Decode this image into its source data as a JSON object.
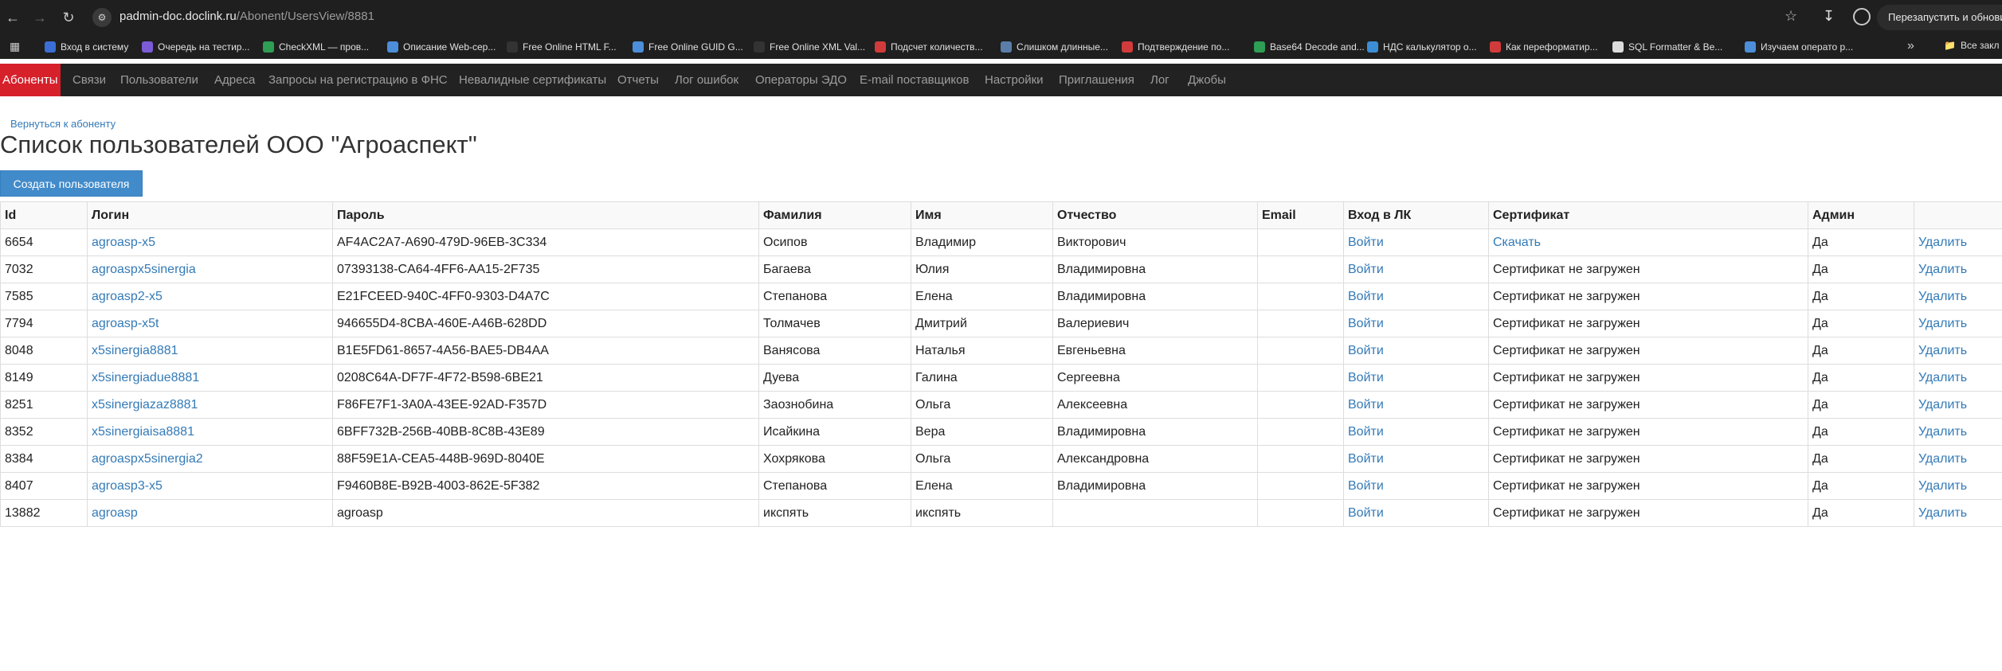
{
  "browser": {
    "url_host": "padmin-doc.doclink.ru",
    "url_path": "/Abonent/UsersView/8881",
    "relaunch_label": "Перезапустить и обновит"
  },
  "bookmarks": [
    {
      "label": "Вход в систему",
      "color": "#3b6fd6"
    },
    {
      "label": "Очередь на тестир...",
      "color": "#7b5cd6"
    },
    {
      "label": "CheckXML — пров...",
      "color": "#2e9e55"
    },
    {
      "label": "Описание Web-сер...",
      "color": "#4c8ed9"
    },
    {
      "label": "Free Online HTML F...",
      "color": "#333333"
    },
    {
      "label": "Free Online GUID G...",
      "color": "#4c8ed9"
    },
    {
      "label": "Free Online XML Val...",
      "color": "#333333"
    },
    {
      "label": "Подсчет количеств...",
      "color": "#d23b3b"
    },
    {
      "label": "Слишком длинные...",
      "color": "#5b7ea8"
    },
    {
      "label": "Подтверждение по...",
      "color": "#d23b3b"
    },
    {
      "label": "Base64 Decode and...",
      "color": "#2e9e55"
    },
    {
      "label": "НДС калькулятор о...",
      "color": "#3b8ed6"
    },
    {
      "label": "Как переформатир...",
      "color": "#d23b3b"
    },
    {
      "label": "SQL Formatter & Be...",
      "color": "#dddddd"
    },
    {
      "label": "Изучаем операто р...",
      "color": "#4c8ed9"
    }
  ],
  "bookmarks_folder": "Все закл",
  "nav": {
    "items": [
      "Абоненты",
      "Связи",
      "Пользователи",
      "Адреса",
      "Запросы на регистрацию в ФНС",
      "Невалидные сертификаты",
      "Отчеты",
      "Лог ошибок",
      "Операторы ЭДО",
      "E-mail поставщиков",
      "Настройки",
      "Приглашения",
      "Лог",
      "Джобы"
    ],
    "active": "Абоненты"
  },
  "back_link": "Вернуться к абоненту",
  "page_title": "Список пользователей ООО \"Агроаспект\"",
  "create_button": "Создать пользователя",
  "table": {
    "headers": [
      "Id",
      "Логин",
      "Пароль",
      "Фамилия",
      "Имя",
      "Отчество",
      "Email",
      "Вход в ЛК",
      "Сертификат",
      "Админ",
      ""
    ],
    "rows": [
      [
        "6654",
        "agroasp-x5",
        "AF4AC2A7-A690-479D-96EB-3C334",
        "Осипов",
        "Владимир",
        "Викторович",
        "",
        "Войти",
        "Скачать",
        "Да",
        "Удалить"
      ],
      [
        "7032",
        "agroaspx5sinergia",
        "07393138-CA64-4FF6-AA15-2F735",
        "Багаева",
        "Юлия",
        "Владимировна",
        "",
        "Войти",
        "Сертификат не загружен",
        "Да",
        "Удалить"
      ],
      [
        "7585",
        "agroasp2-x5",
        "E21FCEED-940C-4FF0-9303-D4A7C",
        "Степанова",
        "Елена",
        "Владимировна",
        "",
        "Войти",
        "Сертификат не загружен",
        "Да",
        "Удалить"
      ],
      [
        "7794",
        "agroasp-x5t",
        "946655D4-8CBA-460E-A46B-628DD",
        "Толмачев",
        "Дмитрий",
        "Валериевич",
        "",
        "Войти",
        "Сертификат не загружен",
        "Да",
        "Удалить"
      ],
      [
        "8048",
        "x5sinergia8881",
        "B1E5FD61-8657-4A56-BAE5-DB4AA",
        "Ванясова",
        "Наталья",
        "Евгеньевна",
        "",
        "Войти",
        "Сертификат не загружен",
        "Да",
        "Удалить"
      ],
      [
        "8149",
        "x5sinergiadue8881",
        "0208C64A-DF7F-4F72-B598-6BE21",
        "Дуева",
        "Галина",
        "Сергеевна",
        "",
        "Войти",
        "Сертификат не загружен",
        "Да",
        "Удалить"
      ],
      [
        "8251",
        "x5sinergiazaz8881",
        "F86FE7F1-3A0A-43EE-92AD-F357D",
        "Заознобина",
        "Ольга",
        "Алексеевна",
        "",
        "Войти",
        "Сертификат не загружен",
        "Да",
        "Удалить"
      ],
      [
        "8352",
        "x5sinergiaisa8881",
        "6BFF732B-256B-40BB-8C8B-43E89",
        "Исайкина",
        "Вера",
        "Владимировна",
        "",
        "Войти",
        "Сертификат не загружен",
        "Да",
        "Удалить"
      ],
      [
        "8384",
        "agroaspx5sinergia2",
        "88F59E1A-CEA5-448B-969D-8040E",
        "Хохрякова",
        "Ольга",
        "Александровна",
        "",
        "Войти",
        "Сертификат не загружен",
        "Да",
        "Удалить"
      ],
      [
        "8407",
        "agroasp3-x5",
        "F9460B8E-B92B-4003-862E-5F382",
        "Степанова",
        "Елена",
        "Владимировна",
        "",
        "Войти",
        "Сертификат не загружен",
        "Да",
        "Удалить"
      ],
      [
        "13882",
        "agroasp",
        "agroasp",
        "икспять",
        "икспять",
        "",
        "",
        "Войти",
        "Сертификат не загружен",
        "Да",
        "Удалить"
      ]
    ]
  }
}
